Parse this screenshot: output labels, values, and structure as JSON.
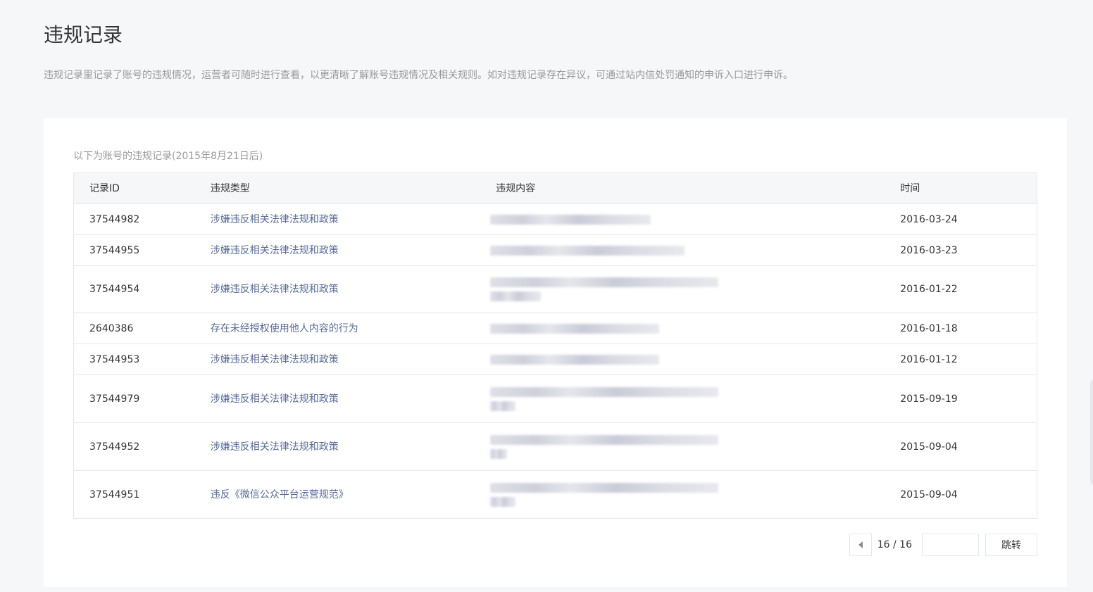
{
  "header": {
    "title": "违规记录",
    "description": "违规记录里记录了账号的违规情况，运营者可随时进行查看，以更清晰了解账号违规情况及相关规则。如对违规记录存在异议，可通过站内信处罚通知的申诉入口进行申诉。"
  },
  "records": {
    "subtitle": "以下为账号的违规记录(2015年8月21日后)",
    "columns": {
      "id": "记录ID",
      "type": "违规类型",
      "content": "违规内容",
      "time": "时间"
    },
    "rows": [
      {
        "id": "37544982",
        "type": "涉嫌违反相关法律法规和政策",
        "time": "2016-03-24"
      },
      {
        "id": "37544955",
        "type": "涉嫌违反相关法律法规和政策",
        "time": "2016-03-23"
      },
      {
        "id": "37544954",
        "type": "涉嫌违反相关法律法规和政策",
        "time": "2016-01-22"
      },
      {
        "id": "2640386",
        "type": "存在未经授权使用他人内容的行为",
        "time": "2016-01-18"
      },
      {
        "id": "37544953",
        "type": "涉嫌违反相关法律法规和政策",
        "time": "2016-01-12"
      },
      {
        "id": "37544979",
        "type": "涉嫌违反相关法律法规和政策",
        "time": "2015-09-19"
      },
      {
        "id": "37544952",
        "type": "涉嫌违反相关法律法规和政策",
        "time": "2015-09-04"
      },
      {
        "id": "37544951",
        "type": "违反《微信公众平台运营规范》",
        "time": "2015-09-04"
      }
    ]
  },
  "pagination": {
    "page_label": "16 / 16",
    "input_value": "",
    "jump_label": "跳转",
    "prev_icon": "triangle-left-icon"
  },
  "colors": {
    "link": "#576b95",
    "background": "#f6f7f9",
    "border": "#e7e7eb"
  }
}
